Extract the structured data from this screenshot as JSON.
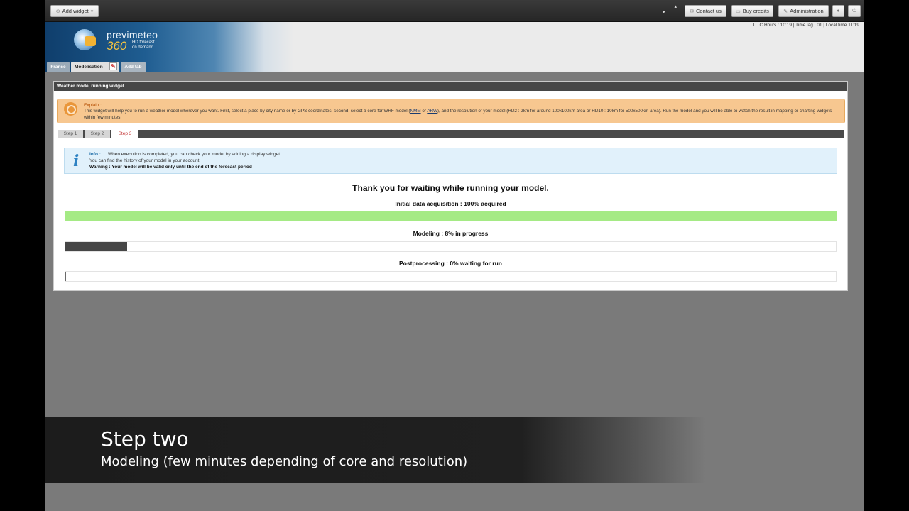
{
  "toolbar": {
    "add_widget": "Add widget",
    "contact_us": "Contact us",
    "buy_credits": "Buy credits",
    "administration": "Administration"
  },
  "header": {
    "brand": "previmeteo",
    "brand_number": "360",
    "tagline_line1": "HD forecast",
    "tagline_line2": "on demand",
    "time_info": "UTC Hours : 10:19  |  Time lag : 01  |  Local time 11:19"
  },
  "tabs": [
    {
      "label": "France"
    },
    {
      "label": "Modelisation"
    },
    {
      "label": "Add tab"
    }
  ],
  "widget": {
    "title": "Weather model running widget",
    "explain": {
      "title": "Explain :",
      "text_before": "This widget will help you to run a weather model wherever you want. First, select a place by city name or by GPS coordinates, second, select a core for WRF model (",
      "link_nmm": "NMM",
      "text_or": " or ",
      "link_arw": "ARW",
      "text_after": "), and the resolution of your model (HD2 : 2km for around 100x100km area or HD10 : 10km for 500x500km area). Run the model and you will be able to watch the result in mapping or charting widgets within few minutes."
    },
    "steps": [
      "Step 1",
      "Step 2",
      "Step 3"
    ],
    "active_step": 3,
    "info": {
      "title": "Info :",
      "line1": "When execution is completed, you can check your model by adding a display widget.",
      "line2": "You can find the history of your model in your account.",
      "warning": "Warning : Your model will be valid only until the end of the forecast period"
    },
    "thanks": "Thank you for waiting while running your model.",
    "stages": [
      {
        "label": "Initial data acquisition : 100% acquired",
        "progress": 100
      },
      {
        "label": "Modeling : 8% in progress",
        "progress": 8
      },
      {
        "label": "Postprocessing : 0% waiting for run",
        "progress": 0
      }
    ]
  },
  "caption": {
    "title": "Step two",
    "subtitle": "Modeling (few minutes depending of core and resolution)"
  },
  "colors": {
    "progress_complete": "#a5ea85",
    "progress_running": "#464646",
    "explain_bg": "#f7c790",
    "info_bg": "#e1f1fb"
  }
}
